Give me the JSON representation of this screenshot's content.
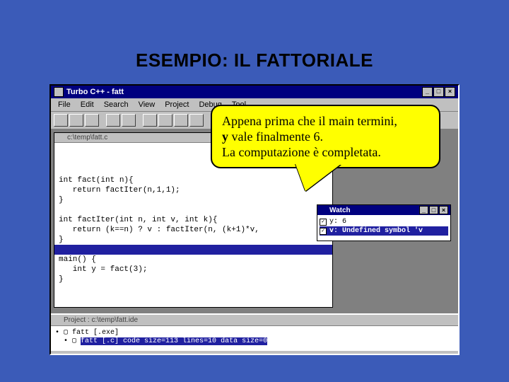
{
  "slide": {
    "title": "ESEMPIO: IL FATTORIALE"
  },
  "ide": {
    "title": "Turbo C++ - fatt",
    "menu": [
      "File",
      "Edit",
      "Search",
      "View",
      "Project",
      "Debug",
      "Tool"
    ],
    "code_window_title": "c:\\temp\\fatt.c",
    "code": "int fact(int n){\n   return factIter(n,1,1);\n}\n\nint factIter(int n, int v, int k){\n   return (k==n) ? v : factIter(n, (k+1)*v,\n}\n\nmain() {\n   int y = fact(3);\n}",
    "watch": {
      "title": "Watch",
      "rows": [
        {
          "expr": "y: 6",
          "selected": false
        },
        {
          "expr": "v: Undefined symbol 'v",
          "selected": true
        }
      ]
    },
    "project": {
      "title": "Project : c:\\temp\\fatt.ide",
      "items": [
        {
          "text": "fatt [.exe]",
          "selected": false
        },
        {
          "text": "fatt [.c]  code size=113  lines=10  data size=0",
          "selected": true
        }
      ]
    },
    "status": {
      "left": "",
      "right": ""
    }
  },
  "callout": {
    "line1": "Appena prima che il main termini,",
    "line2_bold": "y",
    "line2_rest": " vale finalmente 6.",
    "line3": "La computazione è completata."
  }
}
